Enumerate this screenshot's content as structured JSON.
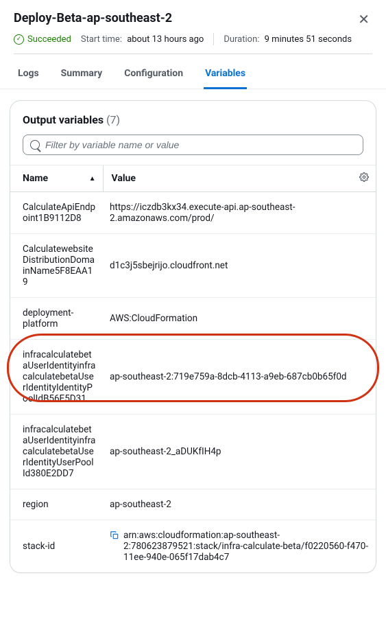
{
  "header": {
    "title": "Deploy-Beta-ap-southeast-2",
    "status": "Succeeded",
    "start_label": "Start time:",
    "start_value": "about 13 hours ago",
    "duration_label": "Duration:",
    "duration_value": "9 minutes 51 seconds"
  },
  "tabs": {
    "logs": "Logs",
    "summary": "Summary",
    "configuration": "Configuration",
    "variables": "Variables"
  },
  "card": {
    "title": "Output variables",
    "count_text": "(7)",
    "filter_placeholder": "Filter by variable name or value",
    "col_name": "Name",
    "col_value": "Value",
    "rows": [
      {
        "name": "CalculateApiEndpoint1B9112D8",
        "value": "https://iczdb3kx34.execute-api.ap-southeast-2.amazonaws.com/prod/"
      },
      {
        "name": "CalculatewebsiteDistributionDomainName5F8EAA19",
        "value": "d1c3j5sbejrijo.cloudfront.net"
      },
      {
        "name": "deployment-platform",
        "value": "AWS:CloudFormation"
      },
      {
        "name": "infracalculatebetaUserIdentityinfracalculatebetaUserIdentityIdentityPoolIdB56E5D31",
        "value": "ap-southeast-2:719e759a-8dcb-4113-a9eb-687cb0b65f0d"
      },
      {
        "name": "infracalculatebetaUserIdentityinfracalculatebetaUserIdentityUserPoolId380E2DD7",
        "value": "ap-southeast-2_aDUKfIH4p"
      },
      {
        "name": "region",
        "value": "ap-southeast-2"
      },
      {
        "name": "stack-id",
        "value": "arn:aws:cloudformation:ap-southeast-2:780623879521:stack/infra-calculate-beta/f0220560-f470-11ee-940e-065f17dab4c7"
      }
    ]
  }
}
